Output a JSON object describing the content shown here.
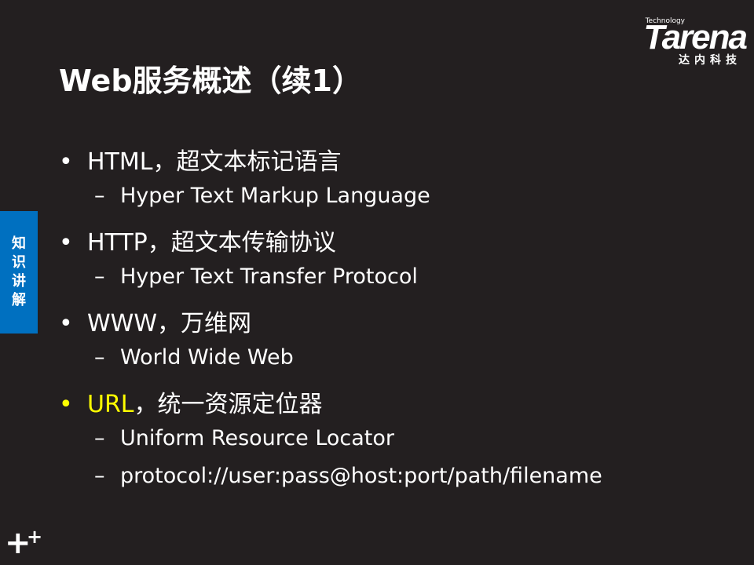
{
  "title": "Web服务概述（续1）",
  "logo": {
    "tech": "Technology",
    "word": "Tarena",
    "cn": "达内科技"
  },
  "side_tab": [
    "知",
    "识",
    "讲",
    "解"
  ],
  "bullets": [
    {
      "text": "HTML，超文本标记语言",
      "sub": [
        "Hyper Text Markup Language"
      ]
    },
    {
      "text": "HTTP，超文本传输协议",
      "sub": [
        "Hyper Text Transfer Protocol"
      ]
    },
    {
      "text": "WWW，万维网",
      "sub": [
        "World Wide Web"
      ]
    },
    {
      "text_highlight": "URL",
      "text": "，统一资源定位器",
      "sub": [
        "Uniform Resource Locator",
        "protocol://user:pass@host:port/path/filename"
      ]
    }
  ],
  "bullet_glyph": "•",
  "dash_glyph": "–",
  "colors": {
    "background": "#231f20",
    "highlight": "#ffff00",
    "side_tab": "#0070c0"
  }
}
